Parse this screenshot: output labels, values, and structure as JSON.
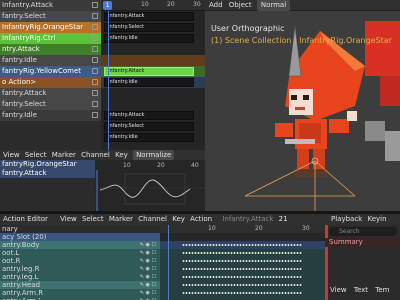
{
  "nla": {
    "rows": [
      {
        "label": "Infantry.Attack",
        "style": "dark"
      },
      {
        "label": "fantry.Select",
        "style": "light"
      },
      {
        "label": "InfantryRig.OrangeStar",
        "style": "orange"
      },
      {
        "label": "InfantryRig.Ctrl",
        "style": "green"
      },
      {
        "label": "ntry.Attack",
        "style": "green-dark"
      },
      {
        "label": "fantry.Idle",
        "style": "light"
      },
      {
        "label": "fantryRig.YellowComet",
        "style": "blue"
      },
      {
        "label": "o Action>",
        "style": "orange-dark"
      },
      {
        "label": "fantry.Attack",
        "style": "light"
      },
      {
        "label": "fantry.Select",
        "style": "light"
      },
      {
        "label": "fantry.Idle",
        "style": "dark"
      }
    ],
    "ruler": {
      "frame": "1",
      "t10": "10",
      "t20": "20",
      "t30": "30"
    },
    "strips": [
      {
        "label": "Infantry.Attack",
        "row": 1
      },
      {
        "label": "Infantry.Select",
        "row": 2
      },
      {
        "label": "Infantry.Idle",
        "row": 3
      },
      {
        "label": "Infantry.Attack",
        "row": 6,
        "active": true
      },
      {
        "label": "Infantry.Idle",
        "row": 7
      },
      {
        "label": "Infantry.Attack",
        "row": 10
      },
      {
        "label": "Infantry.Select",
        "row": 11
      },
      {
        "label": "Infantry.Idle",
        "row": 12
      }
    ]
  },
  "viewport": {
    "menu_add": "Add",
    "menu_object": "Object",
    "orientation": "Normal",
    "title": "User Orthographic",
    "collection": "(1) Scene Collection | InfantryRig.OrangeStar"
  },
  "graph": {
    "menu": [
      "View",
      "Select",
      "Marker",
      "Channel",
      "Key"
    ],
    "normalize": "Normalize",
    "channels": [
      {
        "label": "fantryRig.OrangeStar",
        "sel": true
      },
      {
        "label": "fantry.Attack",
        "sel": true
      }
    ],
    "ticks": [
      "10",
      "20",
      "40"
    ]
  },
  "action_editor": {
    "title": "Action Editor",
    "menu": [
      "View",
      "Select",
      "Marker",
      "Channel",
      "Key",
      "Action"
    ],
    "action_name": "Infantry.Attack",
    "users": "21",
    "channels": [
      {
        "label": "nary",
        "style": "plain"
      },
      {
        "label": "acy Slot (20)",
        "style": "sel-blue"
      },
      {
        "label": "antry.Body",
        "style": "teal-l"
      },
      {
        "label": "oot.L",
        "style": "teal"
      },
      {
        "label": "oot.R",
        "style": "teal"
      },
      {
        "label": "antry.leg.R",
        "style": "teal"
      },
      {
        "label": "antry.leg.L",
        "style": "teal"
      },
      {
        "label": "antry.Head",
        "style": "teal-l"
      },
      {
        "label": "antry.Arm.R",
        "style": "teal"
      },
      {
        "label": "antry.Arm.L",
        "style": "teal"
      }
    ],
    "ruler": {
      "t10": "10",
      "t20": "20",
      "t30": "30"
    }
  },
  "timeline": {
    "playback": "Playback",
    "keying": "Keyin",
    "search_placeholder": "Search",
    "summary": "Summary",
    "footer": [
      "View",
      "Text",
      "Tem"
    ]
  },
  "colors": {
    "frame_marker": "#4d7bd8",
    "active_strip": "#6ad548",
    "character_orange": "#e8451e"
  }
}
